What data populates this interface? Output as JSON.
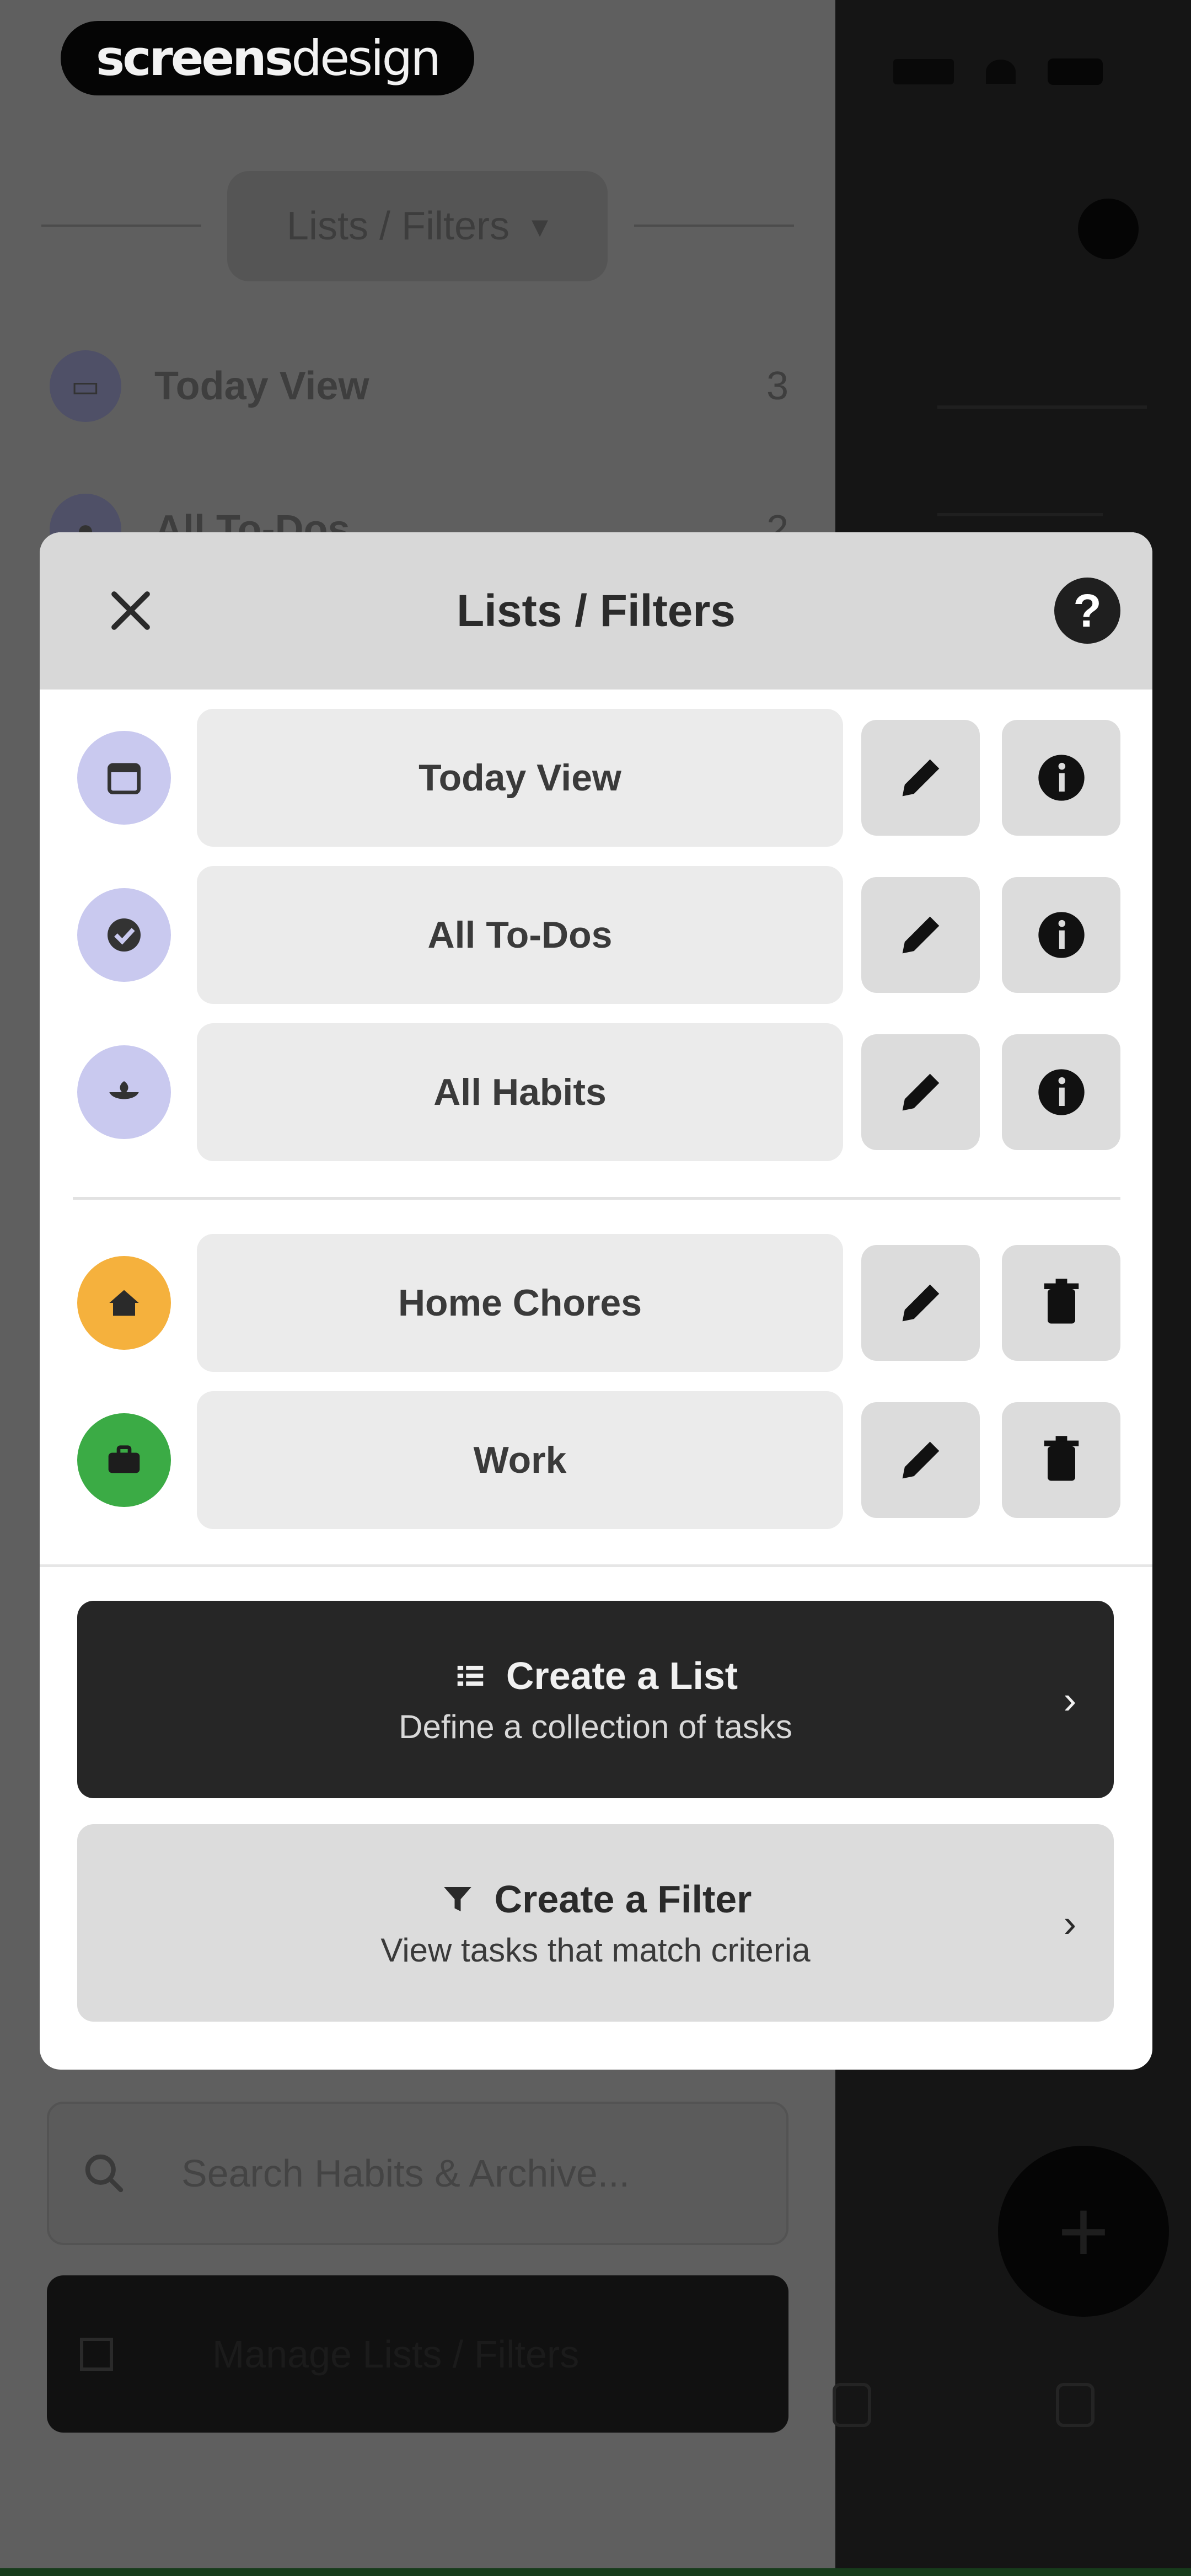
{
  "watermark": {
    "bold": "screens",
    "light": "design"
  },
  "background": {
    "dropdown_label": "Lists / Filters",
    "rows": [
      {
        "label": "Today View",
        "count": "3"
      },
      {
        "label": "All To-Dos",
        "count": "2"
      }
    ],
    "search_placeholder": "Search Habits & Archive...",
    "manage_label": "Manage Lists / Filters",
    "fab_label": "+"
  },
  "modal": {
    "title": "Lists / Filters",
    "help_label": "?",
    "built_in_lists": [
      {
        "label": "Today View",
        "icon": "calendar-icon",
        "icon_bg": "#c9c9ef"
      },
      {
        "label": "All To-Dos",
        "icon": "check-circle-icon",
        "icon_bg": "#c9c9ef"
      },
      {
        "label": "All Habits",
        "icon": "sprout-icon",
        "icon_bg": "#c9c9ef"
      }
    ],
    "custom_lists": [
      {
        "label": "Home Chores",
        "icon": "home-icon",
        "icon_bg": "#f5b13d"
      },
      {
        "label": "Work",
        "icon": "briefcase-icon",
        "icon_bg": "#3bab45"
      }
    ],
    "create_list": {
      "title": "Create a List",
      "subtitle": "Define a collection of tasks",
      "icon": "list-icon"
    },
    "create_filter": {
      "title": "Create a Filter",
      "subtitle": "View tasks that match criteria",
      "icon": "filter-icon"
    }
  },
  "colors": {
    "primary_dark": "#262626",
    "list_purple": "#c9c9ef",
    "chores_orange": "#f5b13d",
    "work_green": "#3bab45"
  }
}
